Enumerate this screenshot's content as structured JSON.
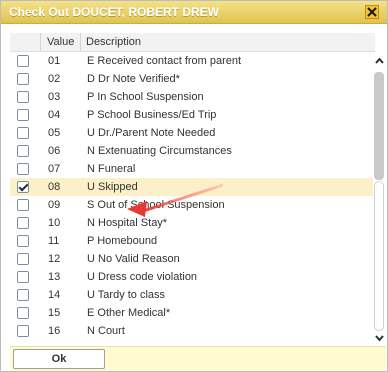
{
  "dialog": {
    "title": "Check Out DOUCET, ROBERT DREW",
    "close_icon": "close-icon"
  },
  "columns": {
    "value": "Value",
    "description": "Description"
  },
  "rows": [
    {
      "value": "01",
      "description": "E Received contact from parent",
      "checked": false
    },
    {
      "value": "02",
      "description": "D Dr Note Verified*",
      "checked": false
    },
    {
      "value": "03",
      "description": "P In School Suspension",
      "checked": false
    },
    {
      "value": "04",
      "description": "P School Business/Ed Trip",
      "checked": false
    },
    {
      "value": "05",
      "description": "U Dr./Parent Note Needed",
      "checked": false
    },
    {
      "value": "06",
      "description": "N Extenuating Circumstances",
      "checked": false
    },
    {
      "value": "07",
      "description": "N Funeral",
      "checked": false
    },
    {
      "value": "08",
      "description": "U Skipped",
      "checked": true
    },
    {
      "value": "09",
      "description": "S Out of School Suspension",
      "checked": false
    },
    {
      "value": "10",
      "description": "N Hospital Stay*",
      "checked": false
    },
    {
      "value": "11",
      "description": "P Homebound",
      "checked": false
    },
    {
      "value": "12",
      "description": "U No Valid Reason",
      "checked": false
    },
    {
      "value": "13",
      "description": "U Dress code violation",
      "checked": false
    },
    {
      "value": "14",
      "description": "U Tardy to class",
      "checked": false
    },
    {
      "value": "15",
      "description": "E Other Medical*",
      "checked": false
    },
    {
      "value": "16",
      "description": "N Court",
      "checked": false
    }
  ],
  "footer": {
    "ok_label": "Ok"
  },
  "colors": {
    "title_bar": "#e6c95a",
    "selected_row": "#fbf0c7",
    "annotation_arrow": "#e53935",
    "footer_bg": "#fffbcf"
  }
}
